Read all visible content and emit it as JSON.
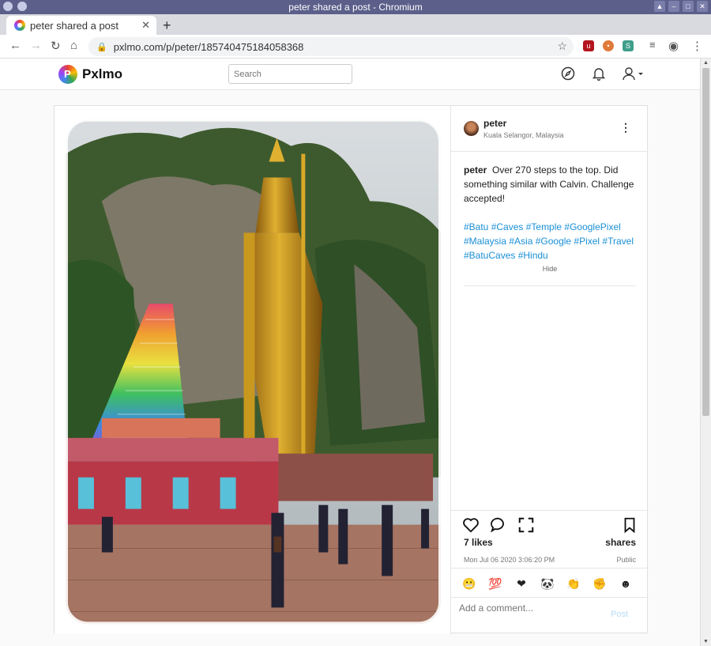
{
  "window": {
    "title": "peter shared a post - Chromium"
  },
  "browser": {
    "tab_title": "peter shared a post",
    "url": "pxlmo.com/p/peter/185740475184058368"
  },
  "site": {
    "logo": "Pxlmo",
    "search_placeholder": "Search"
  },
  "post": {
    "author": "peter",
    "location": "Kuala Selangor, Malaysia",
    "caption_author": "peter",
    "caption": "Over 270 steps to the top. Did something similar with Calvin. Challenge accepted!",
    "hashtags": "#Batu #Caves #Temple #GooglePixel #Malaysia #Asia #Google #Pixel #Travel #BatuCaves #Hindu",
    "hide_label": "Hide",
    "likes": "7 likes",
    "shares": "shares",
    "timestamp": "Mon Jul 06 2020 3:06:20 PM",
    "visibility": "Public",
    "comment_placeholder": "Add a comment...",
    "post_label": "Post",
    "image_subject": "Murugan statue at Batu Caves with rainbow staircase"
  },
  "colors": {
    "accent": "#1a8fd6",
    "title_bar": "#5b5f8a"
  }
}
